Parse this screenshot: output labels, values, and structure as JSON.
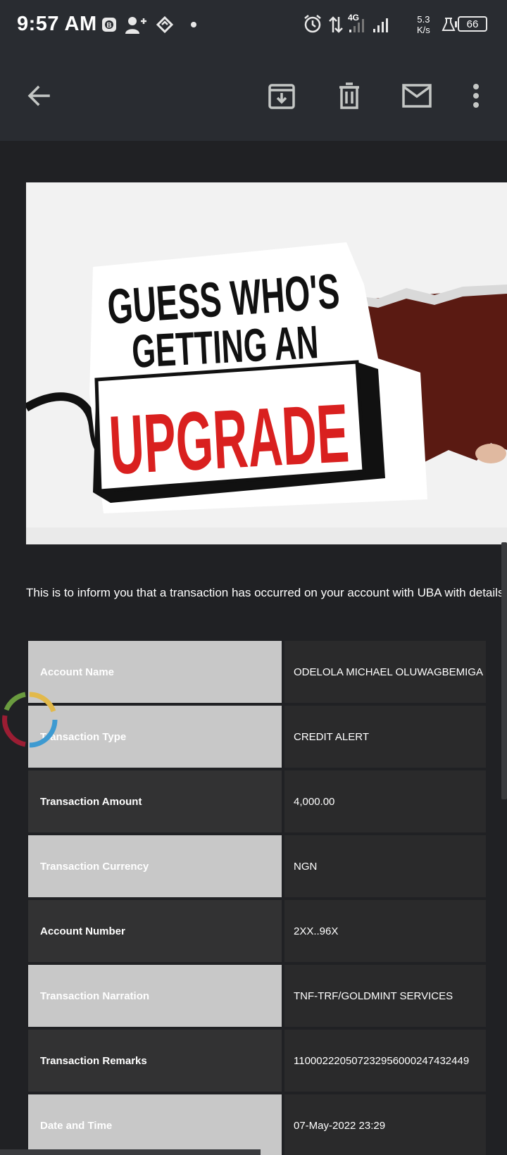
{
  "status_bar": {
    "time": "9:57 AM",
    "network": "4G",
    "speed_value": "5.3",
    "speed_unit": "K/s",
    "battery": "66"
  },
  "toolbar": {
    "back_icon": "arrow-left-icon",
    "archive_icon": "archive-icon",
    "delete_icon": "trash-icon",
    "mark_unread_icon": "mail-icon",
    "more_icon": "more-vert-icon"
  },
  "email": {
    "banner": {
      "line1": "GUESS WHO'S",
      "line2": "GETTING AN",
      "highlight": "UPGRADE"
    },
    "intro_text": "This is to inform you that a transaction has occurred on your account with UBA with details",
    "details": [
      {
        "label": "Account Name",
        "value": "ODELOLA MICHAEL OLUWAGBEMIGA"
      },
      {
        "label": "Transaction Type",
        "value": "CREDIT ALERT"
      },
      {
        "label": "Transaction Amount",
        "value": "4,000.00"
      },
      {
        "label": "Transaction Currency",
        "value": "NGN"
      },
      {
        "label": "Account Number",
        "value": "2XX..96X"
      },
      {
        "label": "Transaction Narration",
        "value": "TNF-TRF/GOLDMINT SERVICES"
      },
      {
        "label": "Transaction Remarks",
        "value": "110002220507232956000247432449"
      },
      {
        "label": "Date and Time",
        "value": "07-May-2022 23:29"
      }
    ]
  },
  "colors": {
    "background": "#202124",
    "toolbar": "#292c31",
    "upgrade_red": "#d9201f"
  }
}
